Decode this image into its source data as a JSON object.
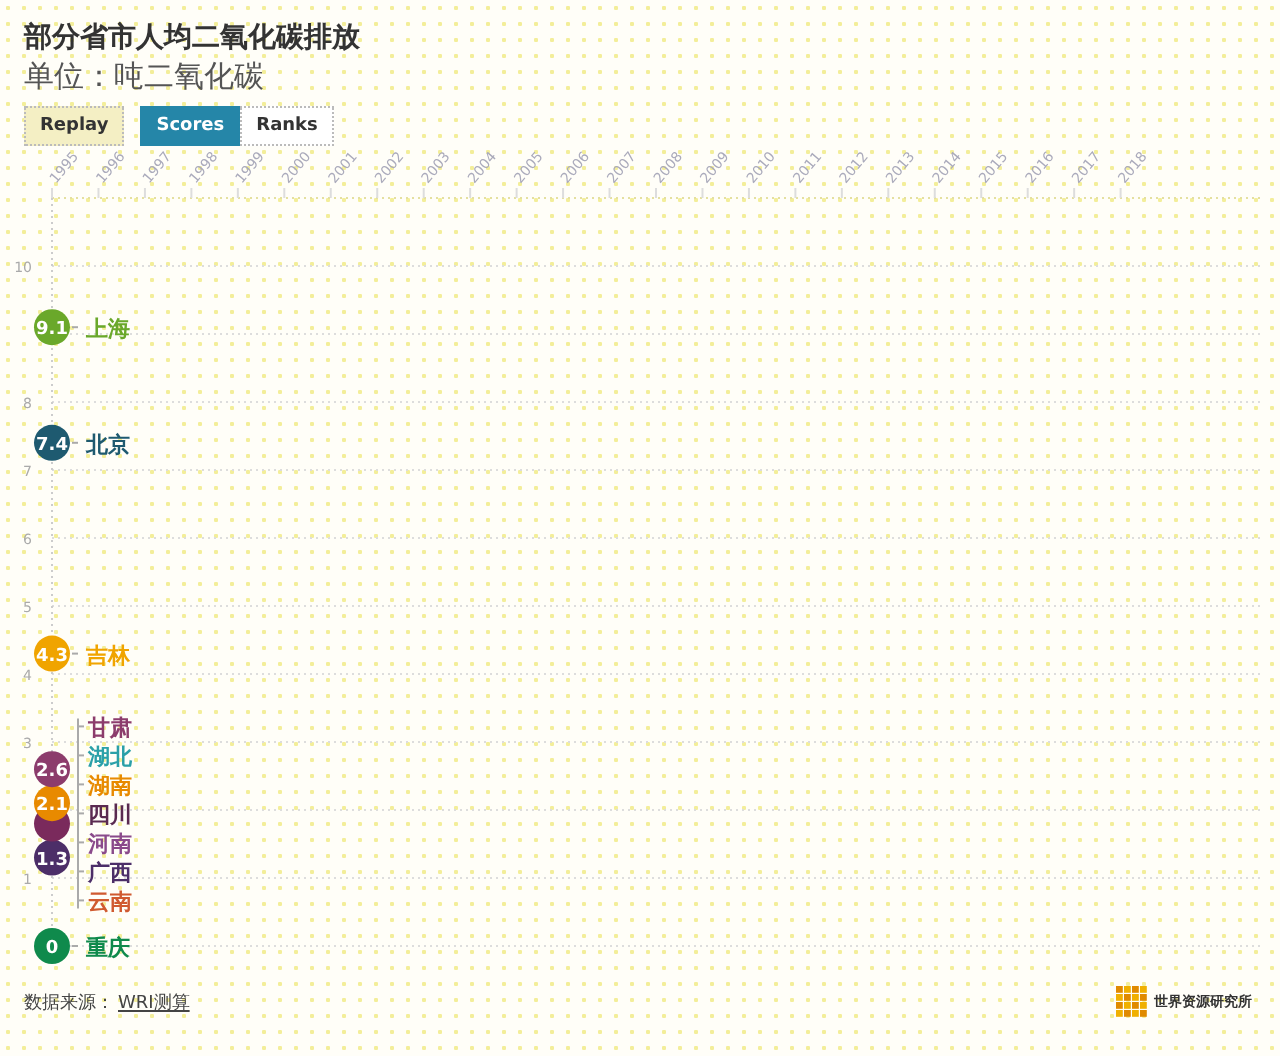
{
  "title": "部分省市人均二氧化碳排放",
  "subtitle": "单位：吨二氧化碳",
  "replay_button": "Replay",
  "tabs": [
    {
      "label": "Scores",
      "selected": true
    },
    {
      "label": "Ranks",
      "selected": false
    }
  ],
  "chart_data": {
    "type": "scatter",
    "grid": true,
    "xlim": [
      1995,
      2021
    ],
    "x": [
      1995
    ],
    "ylim": [
      0,
      11
    ],
    "xticks": [
      {
        "value": 1995,
        "label": "1995"
      },
      {
        "value": 1996,
        "label": "1996"
      },
      {
        "value": 1997,
        "label": "1997"
      },
      {
        "value": 1998,
        "label": "1998"
      },
      {
        "value": 1999,
        "label": "1999"
      },
      {
        "value": 2000,
        "label": "2000"
      },
      {
        "value": 2001,
        "label": "2001"
      },
      {
        "value": 2002,
        "label": "2002"
      },
      {
        "value": 2003,
        "label": "2003"
      },
      {
        "value": 2004,
        "label": "2004"
      },
      {
        "value": 2005,
        "label": "2005"
      },
      {
        "value": 2006,
        "label": "2006"
      },
      {
        "value": 2007,
        "label": "2007"
      },
      {
        "value": 2008,
        "label": "2008"
      },
      {
        "value": 2009,
        "label": "2009"
      },
      {
        "value": 2010,
        "label": "2010"
      },
      {
        "value": 2011,
        "label": "2011"
      },
      {
        "value": 2012,
        "label": "2012"
      },
      {
        "value": 2013,
        "label": "2013"
      },
      {
        "value": 2014,
        "label": "2014"
      },
      {
        "value": 2015,
        "label": "2015"
      },
      {
        "value": 2016,
        "label": "2016"
      },
      {
        "value": 2017,
        "label": "2017"
      },
      {
        "value": 2018,
        "label": "2018"
      }
    ],
    "yticks": [
      {
        "value": 10,
        "label": "10"
      },
      {
        "value": 8,
        "label": "8"
      },
      {
        "value": 7,
        "label": "7"
      },
      {
        "value": 6,
        "label": "6"
      },
      {
        "value": 5,
        "label": "5"
      },
      {
        "value": 4,
        "label": "4"
      },
      {
        "value": 3,
        "label": "3"
      },
      {
        "value": 1,
        "label": "1"
      }
    ],
    "series": [
      {
        "color": "#6aa82a",
        "values": [
          9.1
        ],
        "value_labels": [
          "9.1"
        ]
      },
      {
        "color": "#1e5a70",
        "values": [
          7.4
        ],
        "value_labels": [
          "7.4"
        ]
      },
      {
        "color": "#f0a400",
        "values": [
          4.3
        ],
        "value_labels": [
          "4.3"
        ]
      },
      {
        "color": "#8c3c6c",
        "values": [
          2.6
        ],
        "value_labels": [
          "2.6"
        ]
      },
      {
        "color": "#e88a00",
        "values": [
          2.1
        ],
        "value_labels": [
          "2.1"
        ]
      },
      {
        "color": "#7a2a5c",
        "values": [
          1.8
        ],
        "value_labels": [
          null
        ]
      },
      {
        "color": "#4c2e68",
        "values": [
          1.3
        ],
        "value_labels": [
          "1.3"
        ]
      },
      {
        "color": "#0f8a4c",
        "values": [
          0
        ],
        "value_labels": [
          "0"
        ]
      }
    ]
  },
  "groups": [
    {
      "labels": [
        {
          "name": "上海",
          "color": "#6aa82a"
        }
      ]
    },
    {
      "labels": [
        {
          "name": "北京",
          "color": "#1e5a70"
        }
      ]
    },
    {
      "labels": [
        {
          "name": "吉林",
          "color": "#f0a400"
        }
      ]
    },
    {
      "labels": [
        {
          "name": "甘肃",
          "color": "#8c3c6c"
        },
        {
          "name": "湖北",
          "color": "#2aa0a8"
        },
        {
          "name": "湖南",
          "color": "#e88a00"
        },
        {
          "name": "四川",
          "color": "#5a2a50"
        },
        {
          "name": "河南",
          "color": "#8a4a8a"
        },
        {
          "name": "广西",
          "color": "#4c2e68"
        },
        {
          "name": "云南",
          "color": "#d05a30"
        }
      ]
    },
    {
      "labels": [
        {
          "name": "重庆",
          "color": "#0f8a4c"
        }
      ]
    }
  ],
  "source_label": "数据来源：",
  "source_link": "WRI测算",
  "logo_text": "世界资源研究所"
}
